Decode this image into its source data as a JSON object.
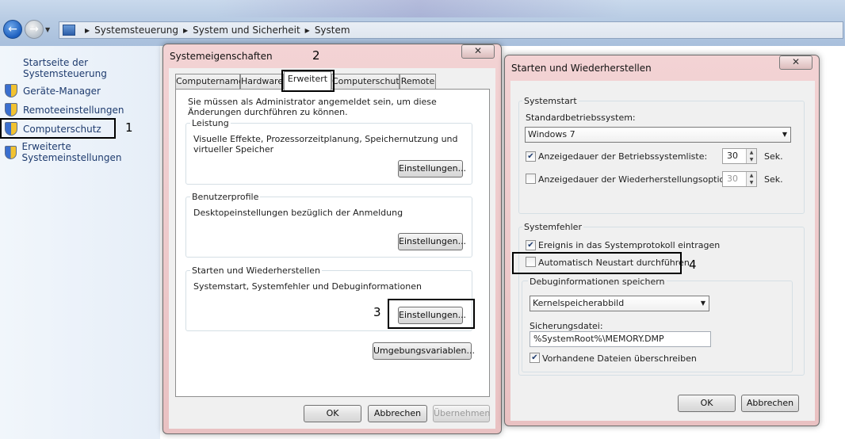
{
  "breadcrumb": [
    "Systemsteuerung",
    "System und Sicherheit",
    "System"
  ],
  "left_pane": {
    "home_link": "Startseite der Systemsteuerung",
    "items": [
      "Geräte-Manager",
      "Remoteeinstellungen",
      "Computerschutz",
      "Erweiterte Systemeinstellungen"
    ]
  },
  "annotations": {
    "n1": "1",
    "n2": "2",
    "n3": "3",
    "n4": "4"
  },
  "sysprops": {
    "title": "Systemeigenschaften",
    "close": "✕",
    "tabs": [
      "Computername",
      "Hardware",
      "Erweitert",
      "Computerschutz",
      "Remote"
    ],
    "admin_note": "Sie müssen als Administrator angemeldet sein, um diese Änderungen durchführen zu können.",
    "perf_label": "Leistung",
    "perf_desc": "Visuelle Effekte, Prozessorzeitplanung, Speichernutzung und virtueller Speicher",
    "profiles_label": "Benutzerprofile",
    "profiles_desc": "Desktopeinstellungen bezüglich der Anmeldung",
    "startup_label": "Starten und Wiederherstellen",
    "startup_desc": "Systemstart, Systemfehler und Debuginformationen",
    "settings_btn": "Einstellungen...",
    "env_btn": "Umgebungsvariablen...",
    "ok": "OK",
    "cancel": "Abbrechen",
    "apply": "Übernehmen"
  },
  "startup": {
    "title": "Starten und Wiederherstellen",
    "close": "✕",
    "systemstart_label": "Systemstart",
    "default_os_label": "Standardbetriebssystem:",
    "default_os_value": "Windows 7",
    "show_list_label": "Anzeigedauer der Betriebssystemliste:",
    "show_list_checked": true,
    "show_list_value": "30",
    "show_recovery_label": "Anzeigedauer der Wiederherstellungsoptionen:",
    "show_recovery_checked": false,
    "show_recovery_value": "30",
    "seconds": "Sek.",
    "systemfehler_label": "Systemfehler",
    "write_event_label": "Ereignis in das Systemprotokoll eintragen",
    "write_event_checked": true,
    "auto_restart_label": "Automatisch Neustart durchführen",
    "auto_restart_checked": false,
    "debug_label": "Debuginformationen speichern",
    "debug_value": "Kernelspeicherabbild",
    "dumpfile_label": "Sicherungsdatei:",
    "dumpfile_value": "%SystemRoot%\\MEMORY.DMP",
    "overwrite_label": "Vorhandene Dateien überschreiben",
    "overwrite_checked": true,
    "ok": "OK",
    "cancel": "Abbrechen"
  }
}
